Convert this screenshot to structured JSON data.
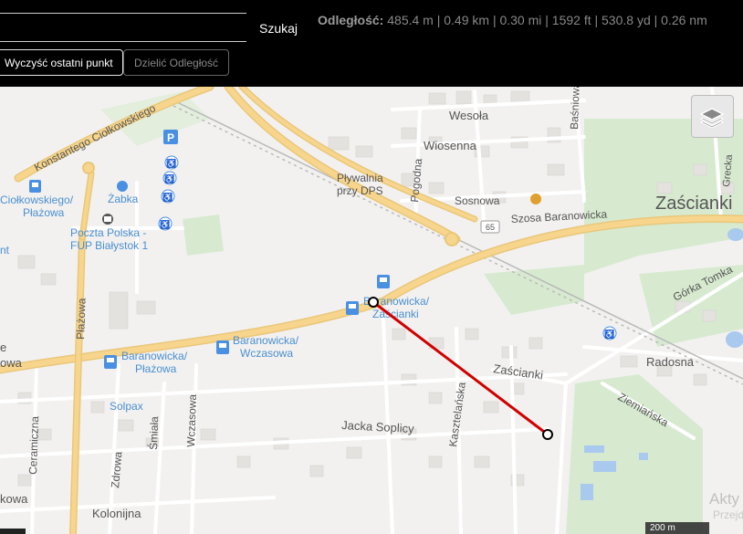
{
  "toolbar": {
    "search_value": "",
    "search_button": "Szukaj",
    "distance_label": "Odległość:",
    "distance_value": "485.4 m | 0.49 km | 0.30 mi | 1592 ft | 530.8 yd | 0.26 nm",
    "clear_button": "Wyczyść ostatni punkt",
    "share_button": "Dzielić Odległość"
  },
  "map": {
    "labels": {
      "konstantego": "Konstantego Ciołkowskiego",
      "wesola": "Wesoła",
      "wiosenna": "Wiosenna",
      "basniowa": "Baśniowa",
      "plywalnia1": "Pływalnia",
      "plywalnia2": "przy DPS",
      "pogodna": "Pogodna",
      "sosnowa": "Sosnowa",
      "zascianki_big": "Zaścianki",
      "grecka": "Grecka",
      "ciolkowskiego1": "Ciołkowskiego/",
      "ciolkowskiego2": "Płażowa",
      "zabka": "Żabka",
      "poczta1": "Poczta Polska -",
      "poczta2": "FUP Białystok 1",
      "szosa": "Szosa Baranowicka",
      "route65": "65",
      "gorka": "Górka Tomka",
      "nt": "nt",
      "baranowicka_z1": "Baranowicka/",
      "baranowicka_z2": "Zaścianki",
      "baranowicka_w1": "Baranowicka/",
      "baranowicka_w2": "Wczasowa",
      "baranowicka_p1": "Baranowicka/",
      "baranowicka_p2": "Płażowa",
      "plazowa": "Płażowa",
      "owa": "owa",
      "e": "e",
      "radosna": "Radosna",
      "zascianki_street": "Zaścianki",
      "kasztelanska": "Kasztelańska",
      "ziemianska": "Ziemiańska",
      "solpax": "Solpax",
      "jacka": "Jacka Soplicy",
      "ceramiczna": "Ceramiczna",
      "smiala": "Śmiała",
      "wczasowa": "Wczasowa",
      "zdrowa": "Zdrowa",
      "kowa": "kowa",
      "kolonijna": "Kolonijna"
    },
    "measure_color": "#d00000",
    "scale_label": "200 m",
    "watermark_line1": "Akty",
    "watermark_line2": "Przejd"
  }
}
